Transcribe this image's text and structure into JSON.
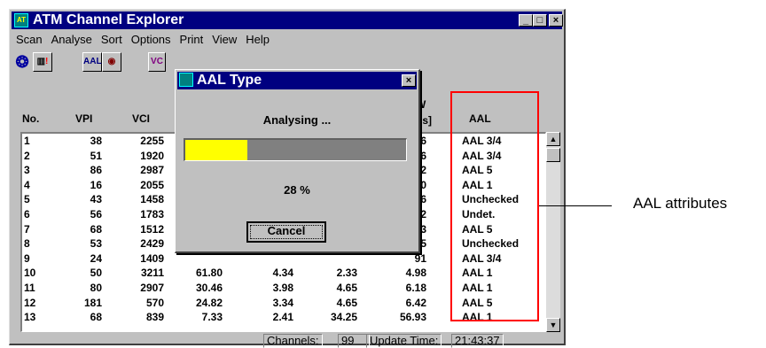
{
  "window": {
    "title": "ATM Channel Explorer"
  },
  "menu": [
    "Scan",
    "Analyse",
    "Sort",
    "Options",
    "Print",
    "View",
    "Help"
  ],
  "columns": {
    "no": "No.",
    "vpi": "VPI",
    "vci": "VCI",
    "bw_top": "W",
    "bw_bottom": "os]",
    "aal": "AAL"
  },
  "rows": [
    {
      "no": "1",
      "vpi": "38",
      "vci": "2255",
      "c4": "",
      "c5": "",
      "c6": "",
      "c7": "36",
      "aal": "AAL 3/4"
    },
    {
      "no": "2",
      "vpi": "51",
      "vci": "1920",
      "c4": "",
      "c5": "",
      "c6": "",
      "c7": "56",
      "aal": "AAL 3/4"
    },
    {
      "no": "3",
      "vpi": "86",
      "vci": "2987",
      "c4": "",
      "c5": "",
      "c6": "",
      "c7": "12",
      "aal": "AAL 5"
    },
    {
      "no": "4",
      "vpi": "16",
      "vci": "2055",
      "c4": "",
      "c5": "",
      "c6": "",
      "c7": "80",
      "aal": "AAL 1"
    },
    {
      "no": "5",
      "vpi": "43",
      "vci": "1458",
      "c4": "",
      "c5": "",
      "c6": "",
      "c7": "86",
      "aal": "Unchecked"
    },
    {
      "no": "6",
      "vpi": "56",
      "vci": "1783",
      "c4": "",
      "c5": "",
      "c6": "",
      "c7": "22",
      "aal": "Undet."
    },
    {
      "no": "7",
      "vpi": "68",
      "vci": "1512",
      "c4": "",
      "c5": "",
      "c6": "",
      "c7": "33",
      "aal": "AAL 5"
    },
    {
      "no": "8",
      "vpi": "53",
      "vci": "2429",
      "c4": "",
      "c5": "",
      "c6": "",
      "c7": "15",
      "aal": "Unchecked"
    },
    {
      "no": "9",
      "vpi": "24",
      "vci": "1409",
      "c4": "",
      "c5": "",
      "c6": "",
      "c7": "91",
      "aal": "AAL 3/4"
    },
    {
      "no": "10",
      "vpi": "50",
      "vci": "3211",
      "c4": "61.80",
      "c5": "4.34",
      "c6": "2.33",
      "c7": "4.98",
      "aal": "AAL 1"
    },
    {
      "no": "11",
      "vpi": "80",
      "vci": "2907",
      "c4": "30.46",
      "c5": "3.98",
      "c6": "4.65",
      "c7": "6.18",
      "aal": "AAL 1"
    },
    {
      "no": "12",
      "vpi": "181",
      "vci": "570",
      "c4": "24.82",
      "c5": "3.34",
      "c6": "4.65",
      "c7": "6.42",
      "aal": "AAL 5"
    },
    {
      "no": "13",
      "vpi": "68",
      "vci": "839",
      "c4": "7.33",
      "c5": "2.41",
      "c6": "34.25",
      "c7": "56.93",
      "aal": "AAL 1"
    }
  ],
  "status": {
    "channels_label": "Channels:",
    "channels_value": "99",
    "update_label": "Update Time:",
    "update_value": "21:43:37"
  },
  "dialog": {
    "title": "AAL Type",
    "message": "Analysing ...",
    "progress": 0.28,
    "percent_text": "28 %",
    "cancel_label": "Cancel"
  },
  "callout": {
    "text": "AAL attributes"
  },
  "colors": {
    "titlebar": "#000080",
    "progress_fill": "#ffff00",
    "highlight": "#ff0000"
  }
}
